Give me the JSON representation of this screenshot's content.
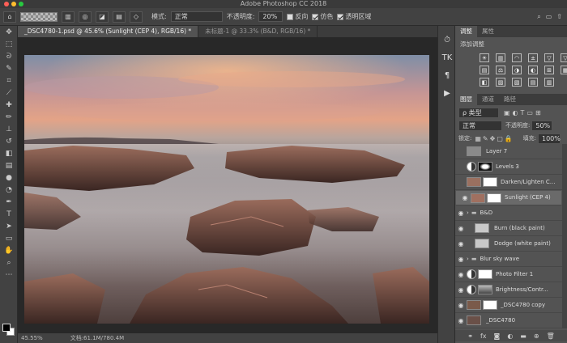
{
  "app_title": "Adobe Photoshop CC 2018",
  "options": {
    "mode_label": "模式:",
    "mode_value": "正常",
    "opacity_label": "不透明度:",
    "opacity_value": "20%",
    "reverse_label": "反向",
    "dither_label": "仿色",
    "transparency_label": "透明区域"
  },
  "doc_tabs": [
    "_DSC4780-1.psd @ 45.6% (Sunlight (CEP 4), RGB/16) *",
    "未标题-1 @ 33.3% (B&D, RGB/16) *"
  ],
  "status": {
    "zoom": "45.55%",
    "doc_size": "文档:61.1M/780.4M"
  },
  "adjustments_panel": {
    "tabs": [
      "调整",
      "属性"
    ],
    "add_label": "添加调整",
    "icons": [
      "brightness-icon",
      "levels-icon",
      "curves-icon",
      "exposure-icon",
      "vibrance-icon",
      "gradient-triangle-icon",
      "hue-saturation-icon",
      "color-balance-icon",
      "black-white-icon",
      "photo-filter-icon",
      "channel-mixer-icon",
      "color-lookup-icon",
      "invert-icon",
      "posterize-icon",
      "threshold-icon",
      "gradient-map-icon",
      "selective-color-icon"
    ]
  },
  "layers_panel": {
    "tabs": [
      "图层",
      "通道",
      "路径"
    ],
    "filter_label": "ρ 类型",
    "blend_mode": "正常",
    "opacity_label": "不透明度:",
    "opacity_value": "50%",
    "lock_label": "锁定:",
    "fill_label": "填充:",
    "fill_value": "100%",
    "layers": [
      {
        "name": "Layer 7",
        "visible": false,
        "kind": "pixel",
        "thumb": "#8a8a8a"
      },
      {
        "name": "Levels 3",
        "visible": false,
        "kind": "adjust",
        "mask": "dark"
      },
      {
        "name": "Darken/Lighten C...",
        "visible": false,
        "kind": "pixel-mask",
        "thumb": "#9a7060"
      },
      {
        "name": "Sunlight (CEP 4)",
        "visible": true,
        "kind": "pixel-mask",
        "thumb": "#a07060",
        "selected": true
      },
      {
        "name": "B&D",
        "visible": true,
        "kind": "group"
      },
      {
        "name": "Burn (black paint)",
        "visible": true,
        "kind": "pixel",
        "thumb": "#c8c8c8",
        "indent": true
      },
      {
        "name": "Dodge (white paint)",
        "visible": true,
        "kind": "pixel",
        "thumb": "#c8c8c8",
        "indent": true
      },
      {
        "name": "Blur sky wave",
        "visible": true,
        "kind": "group"
      },
      {
        "name": "Photo Filter 1",
        "visible": true,
        "kind": "adjust",
        "mask": "white"
      },
      {
        "name": "Brightness/Contr...",
        "visible": true,
        "kind": "adjust",
        "mask": "photo"
      },
      {
        "name": "_DSC4780 copy",
        "visible": true,
        "kind": "pixel-mask",
        "thumb": "#7a5a4a"
      },
      {
        "name": "_DSC4780",
        "visible": true,
        "kind": "pixel",
        "thumb": "#6a5048"
      }
    ],
    "footer_icons": [
      "link-icon",
      "fx-icon",
      "mask-icon",
      "adjustment-icon",
      "folder-icon",
      "new-layer-icon",
      "trash-icon"
    ]
  },
  "toolbar_tools": [
    "move-icon",
    "marquee-icon",
    "lasso-icon",
    "quick-select-icon",
    "crop-icon",
    "eyedropper-icon",
    "healing-icon",
    "brush-icon",
    "clone-stamp-icon",
    "history-brush-icon",
    "eraser-icon",
    "gradient-icon",
    "blur-icon",
    "dodge-icon",
    "pen-icon",
    "type-icon",
    "path-select-icon",
    "shape-icon",
    "hand-icon",
    "zoom-icon",
    "more-icon"
  ]
}
